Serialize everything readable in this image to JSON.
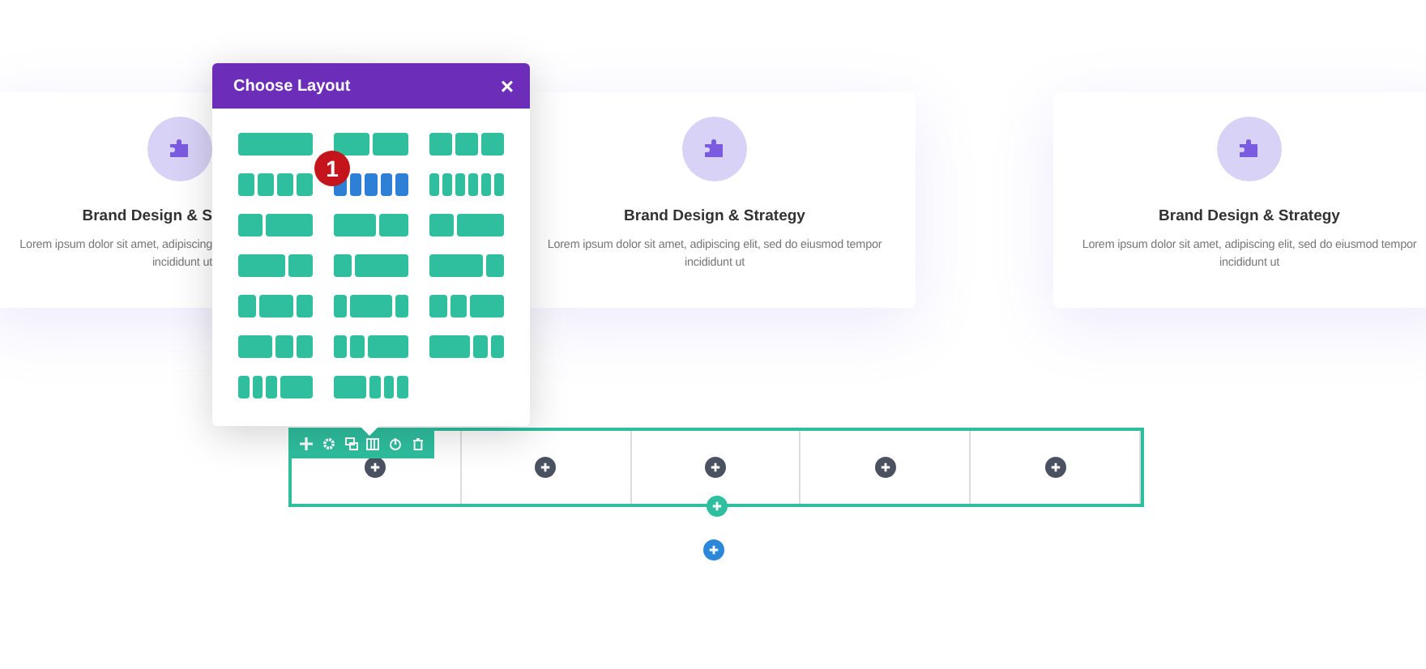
{
  "cards": [
    {
      "title": "Brand Design & S",
      "lines": [
        "Lorem ipsum dolor sit amet, adipiscing",
        "incididunt ut"
      ]
    },
    {
      "title": "Brand Design & Strategy",
      "lines": [
        "Lorem ipsum dolor sit amet, adipiscing elit, sed do eiusmod tempor incididunt ut"
      ]
    },
    {
      "title": "Brand Design & Strategy",
      "lines": [
        "Lorem ipsum dolor sit amet, adipiscing elit, sed do eiusmod tempor incididunt ut"
      ]
    }
  ],
  "layout_popup": {
    "title": "Choose Layout",
    "close": "×",
    "badge": "1",
    "layouts": [
      {
        "kind": "one",
        "selected": false
      },
      {
        "kind": "halves",
        "selected": false
      },
      {
        "kind": "thirds",
        "selected": false
      },
      {
        "kind": "quarters",
        "selected": false
      },
      {
        "kind": "fifths",
        "selected": true
      },
      {
        "kind": "sixths",
        "selected": false
      },
      {
        "kind": "third-twothirds",
        "selected": false
      },
      {
        "kind": "threefifths-twofifths",
        "selected": false
      },
      {
        "kind": "third-twothirds",
        "selected": false
      },
      {
        "kind": "twothirds-third",
        "selected": false
      },
      {
        "kind": "quarter-threequarters",
        "selected": false
      },
      {
        "kind": "threequarters-quarter",
        "selected": false
      },
      {
        "kind": "quarter-half-quarter",
        "selected": false
      },
      {
        "kind": "fifth-threefifths-fifth",
        "selected": false
      },
      {
        "kind": "quarter-quarter-half",
        "selected": false
      },
      {
        "kind": "half-quarter-quarter",
        "selected": false
      },
      {
        "kind": "fifth-fifth-threefifths",
        "selected": false
      },
      {
        "kind": "threefifths-fifth-fifth",
        "selected": false
      },
      {
        "kind": "sixth-sixth-sixth-half",
        "selected": false
      },
      {
        "kind": "half-sixth-sixth-sixth",
        "selected": false
      }
    ]
  },
  "row": {
    "toolbar": [
      {
        "kind": "add"
      },
      {
        "kind": "settings"
      },
      {
        "kind": "duplicate"
      },
      {
        "kind": "columns"
      },
      {
        "kind": "toggle"
      },
      {
        "kind": "delete"
      }
    ],
    "columns": [
      {
        "kind": "empty"
      },
      {
        "kind": "empty"
      },
      {
        "kind": "empty"
      },
      {
        "kind": "empty"
      },
      {
        "kind": "empty"
      }
    ]
  }
}
